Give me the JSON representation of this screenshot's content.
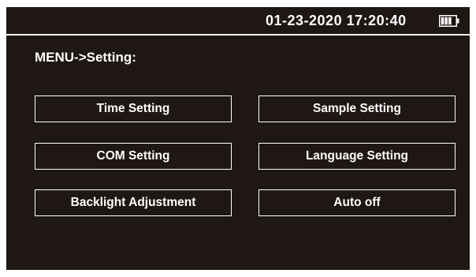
{
  "status_bar": {
    "datetime": "01-23-2020 17:20:40",
    "battery_icon": "battery-icon",
    "battery_level": 0.75
  },
  "menu": {
    "title": "MENU->Setting:",
    "buttons": [
      {
        "label": "Time Setting"
      },
      {
        "label": "Sample Setting"
      },
      {
        "label": "COM Setting"
      },
      {
        "label": "Language Setting"
      },
      {
        "label": "Backlight Adjustment"
      },
      {
        "label": "Auto off"
      }
    ]
  },
  "colors": {
    "background": "#1e1714",
    "foreground": "#ffffff"
  }
}
